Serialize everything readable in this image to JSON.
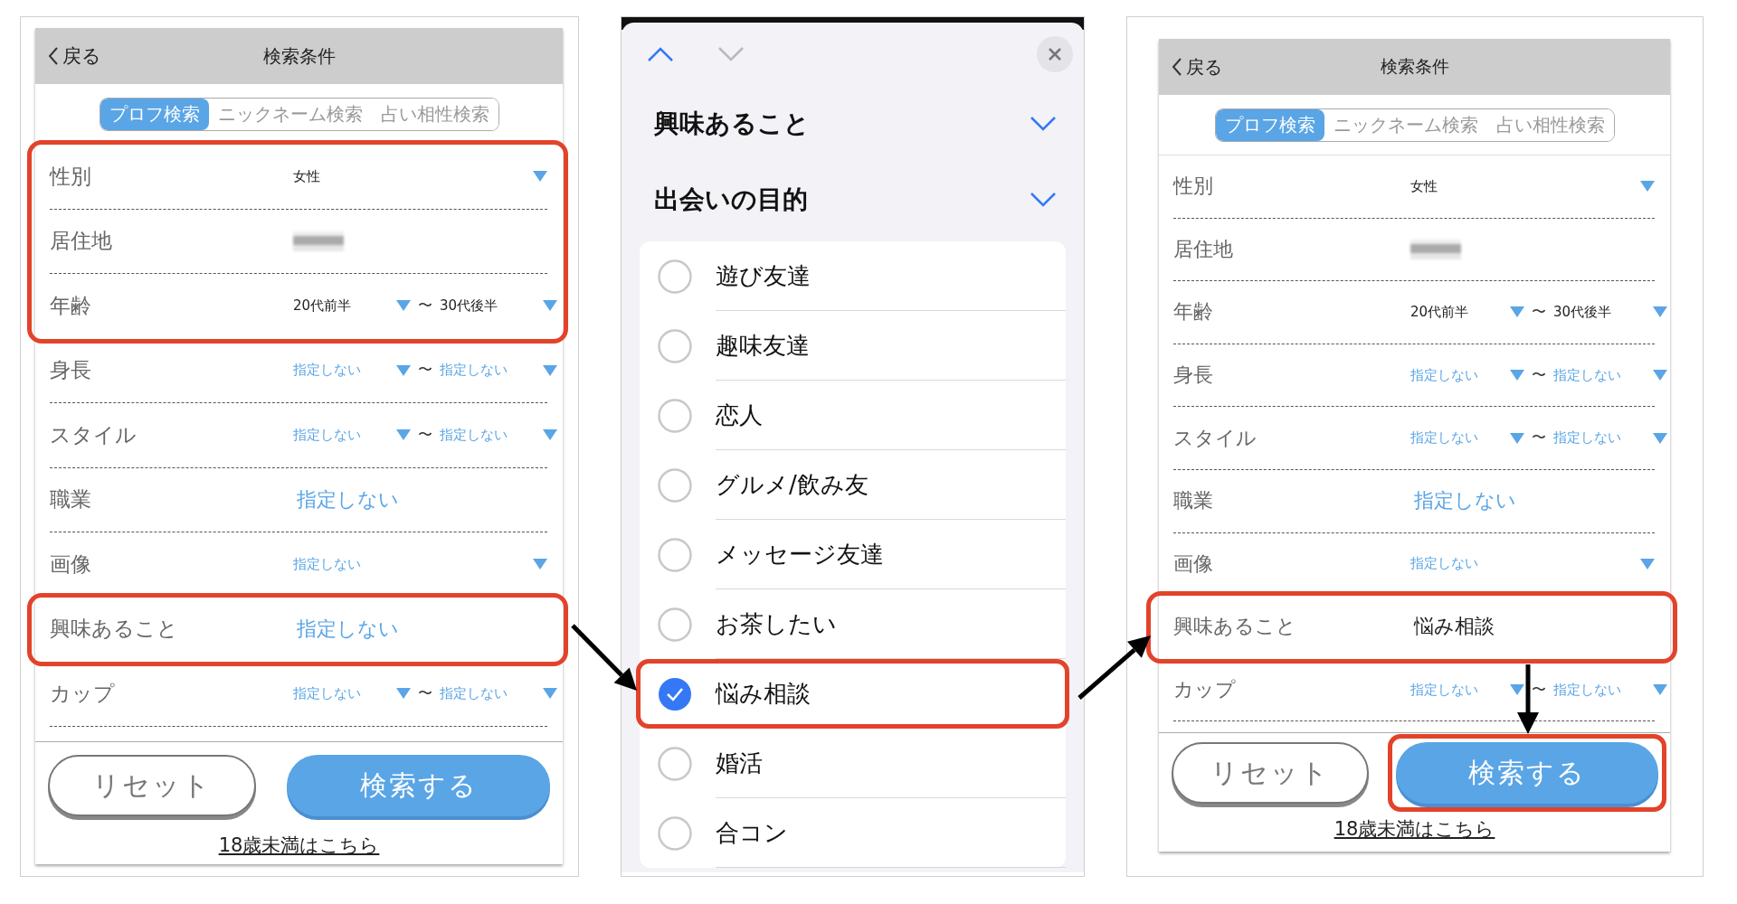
{
  "panels": [
    {
      "kind": "search-form",
      "back": "戻る",
      "title": "検索条件",
      "tabs": [
        {
          "label": "プロフ検索",
          "selected": true
        },
        {
          "label": "ニックネーム検索",
          "selected": false
        },
        {
          "label": "占い相性検索",
          "selected": false
        }
      ],
      "sections": [
        {
          "highlighted": true,
          "rows": [
            {
              "label": "性別",
              "kind": "select",
              "value": {
                "text": "女性",
                "unset": false
              }
            },
            {
              "label": "居住地",
              "kind": "blurred"
            },
            {
              "label": "年齢",
              "kind": "range",
              "from": {
                "text": "20代前半",
                "unset": false
              },
              "separator": "〜",
              "to": {
                "text": "30代後半",
                "unset": false
              }
            }
          ]
        },
        {
          "highlighted": false,
          "rows": [
            {
              "label": "身長",
              "kind": "range",
              "from": {
                "text": "指定しない",
                "unset": true
              },
              "separator": "〜",
              "to": {
                "text": "指定しない",
                "unset": true
              }
            },
            {
              "label": "スタイル",
              "kind": "range",
              "from": {
                "text": "指定しない",
                "unset": true
              },
              "separator": "〜",
              "to": {
                "text": "指定しない",
                "unset": true
              }
            },
            {
              "label": "職業",
              "kind": "plain",
              "value": {
                "text": "指定しない",
                "unset": true
              }
            },
            {
              "label": "画像",
              "kind": "select",
              "value": {
                "text": "指定しない",
                "unset": true
              }
            }
          ]
        },
        {
          "highlighted": true,
          "rows": [
            {
              "label": "興味あること",
              "kind": "plain",
              "value": {
                "text": "指定しない",
                "unset": true
              }
            }
          ]
        },
        {
          "highlighted": false,
          "rows": [
            {
              "label": "カップ",
              "kind": "range",
              "from": {
                "text": "指定しない",
                "unset": true
              },
              "separator": "〜",
              "to": {
                "text": "指定しない",
                "unset": true
              }
            }
          ]
        }
      ],
      "buttons": [
        {
          "kind": "reset",
          "label": "リセット",
          "highlighted": false
        },
        {
          "kind": "search",
          "label": "検索する",
          "highlighted": false
        }
      ],
      "link": "18歳未満はこちら"
    },
    {
      "kind": "picker",
      "up_enabled": true,
      "down_enabled": false,
      "groups": [
        {
          "title": "興味あること"
        },
        {
          "title": "出会いの目的"
        }
      ],
      "options": [
        {
          "label": "遊び友達",
          "selected": false,
          "highlighted": false
        },
        {
          "label": "趣味友達",
          "selected": false,
          "highlighted": false
        },
        {
          "label": "恋人",
          "selected": false,
          "highlighted": false
        },
        {
          "label": "グルメ/飲み友",
          "selected": false,
          "highlighted": false
        },
        {
          "label": "メッセージ友達",
          "selected": false,
          "highlighted": false
        },
        {
          "label": "お茶したい",
          "selected": false,
          "highlighted": false
        },
        {
          "label": "悩み相談",
          "selected": true,
          "highlighted": true
        },
        {
          "label": "婚活",
          "selected": false,
          "highlighted": false
        },
        {
          "label": "合コン",
          "selected": false,
          "highlighted": false
        }
      ]
    },
    {
      "kind": "search-form",
      "back": "戻る",
      "title": "検索条件",
      "tabs": [
        {
          "label": "プロフ検索",
          "selected": true
        },
        {
          "label": "ニックネーム検索",
          "selected": false
        },
        {
          "label": "占い相性検索",
          "selected": false
        }
      ],
      "sections": [
        {
          "highlighted": false,
          "rows": [
            {
              "label": "性別",
              "kind": "select",
              "value": {
                "text": "女性",
                "unset": false
              }
            },
            {
              "label": "居住地",
              "kind": "blurred"
            },
            {
              "label": "年齢",
              "kind": "range",
              "from": {
                "text": "20代前半",
                "unset": false
              },
              "separator": "〜",
              "to": {
                "text": "30代後半",
                "unset": false
              }
            },
            {
              "label": "身長",
              "kind": "range",
              "from": {
                "text": "指定しない",
                "unset": true
              },
              "separator": "〜",
              "to": {
                "text": "指定しない",
                "unset": true
              }
            },
            {
              "label": "スタイル",
              "kind": "range",
              "from": {
                "text": "指定しない",
                "unset": true
              },
              "separator": "〜",
              "to": {
                "text": "指定しない",
                "unset": true
              }
            },
            {
              "label": "職業",
              "kind": "plain",
              "value": {
                "text": "指定しない",
                "unset": true
              }
            },
            {
              "label": "画像",
              "kind": "select",
              "value": {
                "text": "指定しない",
                "unset": true
              }
            }
          ]
        },
        {
          "highlighted": true,
          "rows": [
            {
              "label": "興味あること",
              "kind": "plain",
              "value": {
                "text": "悩み相談",
                "unset": false
              }
            }
          ]
        },
        {
          "highlighted": false,
          "rows": [
            {
              "label": "カップ",
              "kind": "range",
              "from": {
                "text": "指定しない",
                "unset": true
              },
              "separator": "〜",
              "to": {
                "text": "指定しない",
                "unset": true
              }
            }
          ]
        }
      ],
      "buttons": [
        {
          "kind": "reset",
          "label": "リセット",
          "highlighted": false
        },
        {
          "kind": "search",
          "label": "検索する",
          "highlighted": true
        }
      ],
      "link": "18歳未満はこちら"
    }
  ]
}
